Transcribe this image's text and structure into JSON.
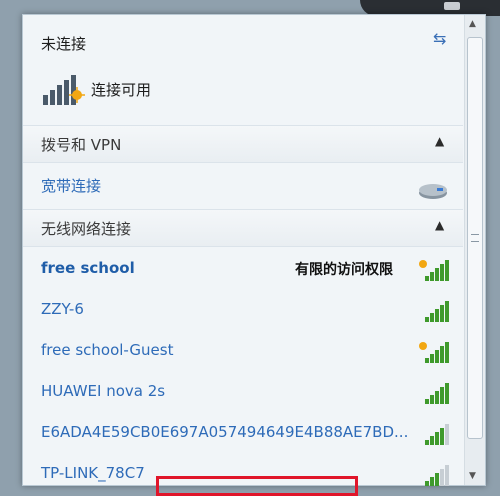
{
  "status": {
    "title": "未连接",
    "connection_label": "连接可用"
  },
  "dialup": {
    "header": "拨号和 VPN",
    "items": [
      {
        "name": "宽带连接"
      }
    ]
  },
  "wireless": {
    "header": "无线网络连接",
    "networks": [
      {
        "name": "free school",
        "status": "有限的访问权限",
        "signal": 5,
        "secure": false
      },
      {
        "name": "ZZY-6",
        "status": "",
        "signal": 5,
        "secure": true
      },
      {
        "name": "free school-Guest",
        "status": "",
        "signal": 5,
        "secure": false
      },
      {
        "name": "HUAWEI nova 2s",
        "status": "",
        "signal": 5,
        "secure": true
      },
      {
        "name": "E6ADA4E59CB0E697A057494649E4B88AE7BD...",
        "status": "",
        "signal": 4,
        "secure": true
      },
      {
        "name": "TP-LINK_78C7",
        "status": "",
        "signal": 3,
        "secure": true
      }
    ]
  },
  "colors": {
    "accent": "#2e6bb8",
    "highlight_box": "#e0152a"
  }
}
